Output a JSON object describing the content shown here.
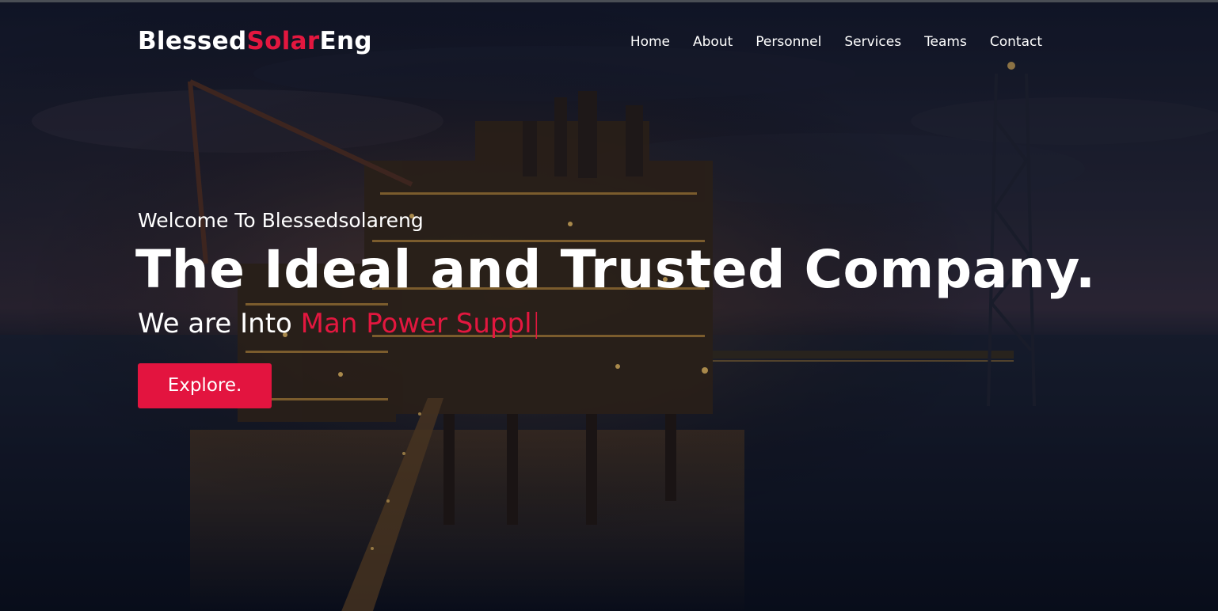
{
  "brand": {
    "part1": "Blessed",
    "part2": "Solar",
    "part3": "Eng",
    "accent_color": "#e3173f"
  },
  "nav": {
    "items": [
      {
        "label": "Home"
      },
      {
        "label": "About"
      },
      {
        "label": "Personnel"
      },
      {
        "label": "Services"
      },
      {
        "label": "Teams"
      },
      {
        "label": "Contact"
      }
    ]
  },
  "hero": {
    "welcome": "Welcome To Blessedsolareng",
    "headline": "The Ideal and Trusted Company.",
    "tagline_prefix": "We are Into ",
    "tagline_typed": "Man Power Suppl",
    "tagline_cursor": "|",
    "cta_label": "Explore."
  },
  "background": {
    "subject": "offshore oil platform at dusk",
    "overlay_color": "#080c1a"
  }
}
